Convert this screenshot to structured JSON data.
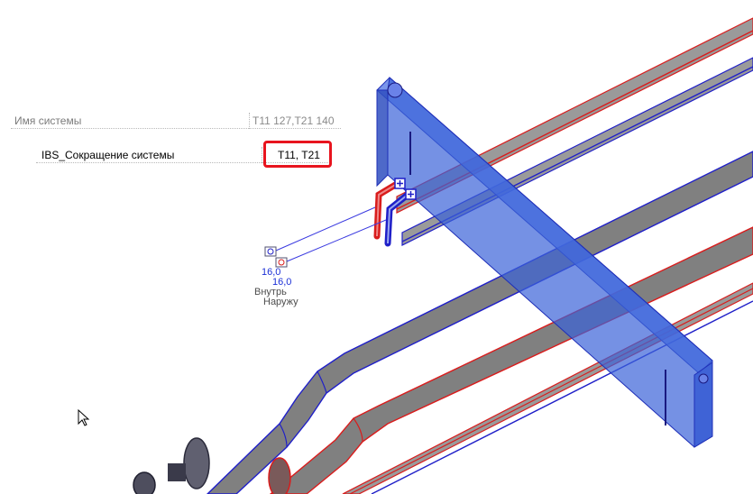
{
  "properties": {
    "system_name": {
      "label": "Имя системы",
      "value": "T11 127,T21 140"
    },
    "short_name": {
      "label": "IBS_Сокращение системы",
      "value": "T11, T21"
    }
  },
  "annotations": {
    "value_inner": "16,0",
    "value_outer": "16,0",
    "label_inner": "Внутрь",
    "label_outer": "Наружу"
  },
  "colors": {
    "duct_fill": "#808080",
    "duct_blue_edge": "#1f1fc8",
    "duct_red_edge": "#d91c1c",
    "box_fill": "#3a62d8",
    "highlight": "#e8141e",
    "annotation_text": "#1b2fd6"
  },
  "icons": [
    "flow-tag-icon",
    "mouse-cursor-icon"
  ]
}
